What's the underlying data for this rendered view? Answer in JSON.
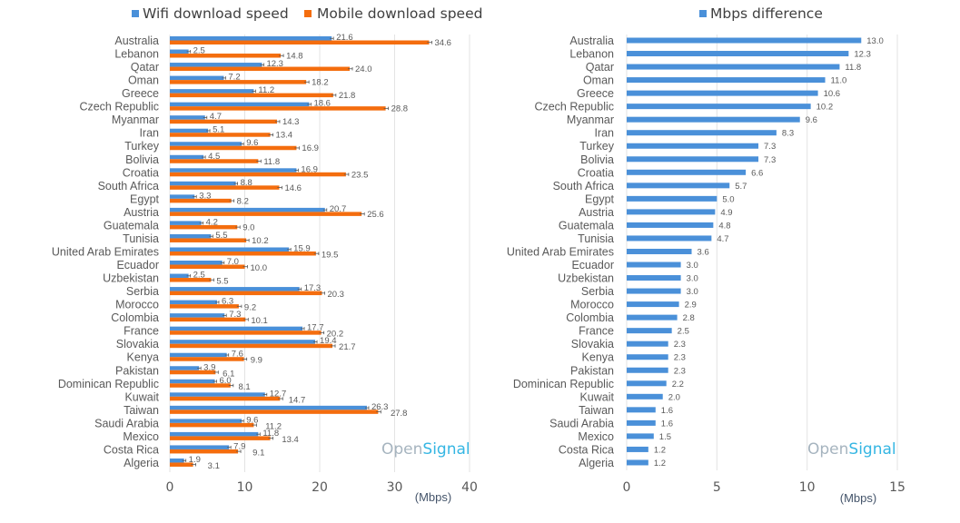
{
  "chart_data": [
    {
      "type": "bar",
      "orientation": "horizontal",
      "title": "",
      "xlabel": "(Mbps)",
      "ylabel": "",
      "xlim": [
        0,
        40
      ],
      "xticks": [
        "0",
        "10",
        "20",
        "30",
        "40"
      ],
      "grid": true,
      "legend": "top",
      "categories": [
        "Australia",
        "Lebanon",
        "Qatar",
        "Oman",
        "Greece",
        "Czech Republic",
        "Myanmar",
        "Iran",
        "Turkey",
        "Bolivia",
        "Croatia",
        "South Africa",
        "Egypt",
        "Austria",
        "Guatemala",
        "Tunisia",
        "United Arab Emirates",
        "Ecuador",
        "Uzbekistan",
        "Serbia",
        "Morocco",
        "Colombia",
        "France",
        "Slovakia",
        "Kenya",
        "Pakistan",
        "Dominican Republic",
        "Kuwait",
        "Taiwan",
        "Saudi Arabia",
        "Mexico",
        "Costa Rica",
        "Algeria"
      ],
      "series": [
        {
          "name": "Wifi download speed",
          "color": "#4a90d9",
          "values": [
            21.6,
            2.5,
            12.3,
            7.2,
            11.2,
            18.6,
            4.7,
            5.1,
            9.6,
            4.5,
            16.9,
            8.8,
            3.3,
            20.7,
            4.2,
            5.5,
            15.9,
            7.0,
            2.5,
            17.3,
            6.3,
            7.3,
            17.7,
            19.4,
            7.6,
            3.9,
            6.0,
            12.7,
            26.3,
            9.6,
            11.8,
            7.9,
            1.9
          ]
        },
        {
          "name": "Mobile download speed",
          "color": "#f46d0e",
          "values": [
            34.6,
            14.8,
            24.0,
            18.2,
            21.8,
            28.8,
            14.3,
            13.4,
            16.9,
            11.8,
            23.5,
            14.6,
            8.2,
            25.6,
            9.0,
            10.2,
            19.5,
            10.0,
            5.5,
            20.3,
            9.2,
            10.1,
            20.2,
            21.7,
            9.9,
            6.1,
            8.1,
            14.7,
            27.8,
            11.2,
            13.4,
            9.1,
            3.1
          ]
        }
      ],
      "annotation": "OpenSignal"
    },
    {
      "type": "bar",
      "orientation": "horizontal",
      "title": "",
      "xlabel": "(Mbps)",
      "ylabel": "",
      "xlim": [
        0,
        15
      ],
      "xticks": [
        "0",
        "5",
        "10",
        "15"
      ],
      "grid": true,
      "legend": "top",
      "categories": [
        "Australia",
        "Lebanon",
        "Qatar",
        "Oman",
        "Greece",
        "Czech Republic",
        "Myanmar",
        "Iran",
        "Turkey",
        "Bolivia",
        "Croatia",
        "South Africa",
        "Egypt",
        "Austria",
        "Guatemala",
        "Tunisia",
        "United Arab Emirates",
        "Ecuador",
        "Uzbekistan",
        "Serbia",
        "Morocco",
        "Colombia",
        "France",
        "Slovakia",
        "Kenya",
        "Pakistan",
        "Dominican Republic",
        "Kuwait",
        "Taiwan",
        "Saudi Arabia",
        "Mexico",
        "Costa Rica",
        "Algeria"
      ],
      "series": [
        {
          "name": "Mbps difference",
          "color": "#4a90d9",
          "values": [
            13.0,
            12.3,
            11.8,
            11.0,
            10.6,
            10.2,
            9.6,
            8.3,
            7.3,
            7.3,
            6.6,
            5.7,
            5.0,
            4.9,
            4.8,
            4.7,
            3.6,
            3.0,
            3.0,
            3.0,
            2.9,
            2.8,
            2.5,
            2.3,
            2.3,
            2.3,
            2.2,
            2.0,
            1.6,
            1.6,
            1.5,
            1.2,
            1.2
          ]
        }
      ],
      "annotation": "OpenSignal"
    }
  ],
  "branding": {
    "part1": "Open",
    "part2": "Signal"
  }
}
